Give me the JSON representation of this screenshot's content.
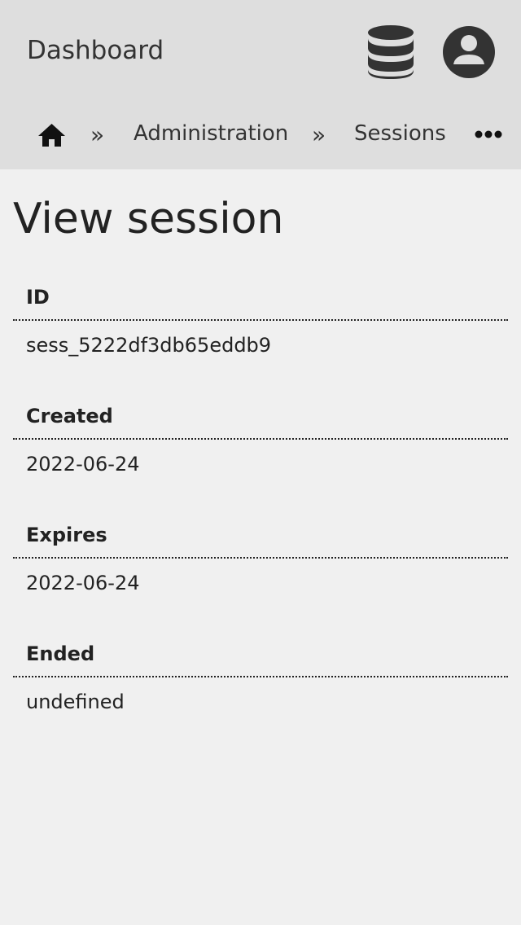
{
  "header": {
    "title": "Dashboard",
    "icons": {
      "database": "database-icon",
      "account": "account-icon"
    }
  },
  "breadcrumb": {
    "home_icon": "home-icon",
    "separator": "»",
    "items": [
      {
        "label": "Administration"
      },
      {
        "label": "Sessions"
      }
    ],
    "more_icon": "more-icon"
  },
  "page": {
    "title": "View session"
  },
  "fields": [
    {
      "label": "ID",
      "value": "sess_5222df3db65eddb9"
    },
    {
      "label": "Created",
      "value": "2022-06-24"
    },
    {
      "label": "Expires",
      "value": "2022-06-24"
    },
    {
      "label": "Ended",
      "value": "undefined"
    }
  ],
  "colors": {
    "header_bg": "#dedede",
    "page_bg": "#f0f0f0",
    "icon": "#333333",
    "text": "#222222"
  }
}
